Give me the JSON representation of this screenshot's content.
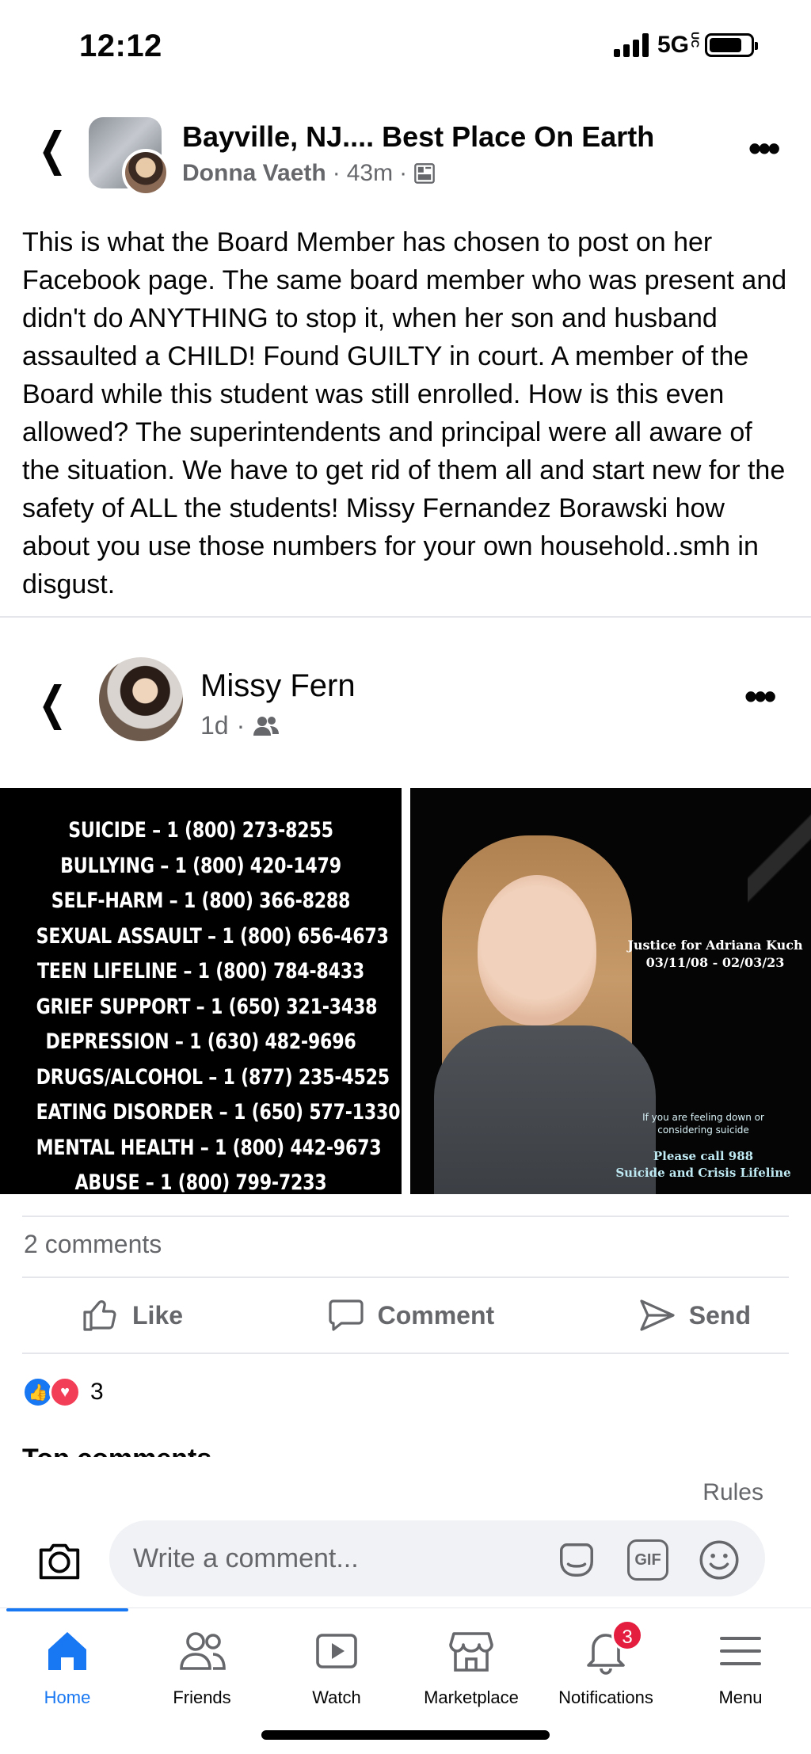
{
  "status_bar": {
    "time": "12:12",
    "network": "5G",
    "network_suffix": "UC"
  },
  "post": {
    "group_name": "Bayville, NJ.... Best Place On Earth",
    "author": "Donna Vaeth",
    "time": "43m",
    "separator": "·",
    "text": "This is what the Board Member has chosen to post on her Facebook page. The same board member who was present and didn't do ANYTHING to stop it, when her son and husband assaulted a CHILD! Found GUILTY in court. A member of the Board while this student was still enrolled. How is this even allowed? The superintendents and principal were all aware of the situation.  We have to get rid of them all and start new for the safety of ALL the students! Missy Fernandez Borawski how about you use those numbers for your own household..smh in disgust.",
    "back_icon": "chevron-left-icon",
    "more_icon": "more-dots-icon"
  },
  "shared_post": {
    "name": "Missy Fern",
    "time": "1d",
    "separator": "·",
    "audience_icon": "friends-icon",
    "hotlines": [
      "SUICIDE – 1 (800) 273-8255",
      "BULLYING – 1 (800) 420-1479",
      "SELF-HARM – 1 (800) 366-8288",
      "SEXUAL ASSAULT – 1 (800) 656-4673",
      "TEEN LIFELINE – 1 (800) 784-8433",
      "GRIEF SUPPORT – 1 (650) 321-3438",
      "DEPRESSION – 1 (630) 482-9696",
      "DRUGS/ALCOHOL – 1 (877) 235-4525",
      "EATING DISORDER – 1 (650) 577-1330",
      "MENTAL HEALTH – 1 (800) 442-9673",
      "ABUSE – 1 (800) 799-7233"
    ],
    "photo_justice_line1": "Justice for Adriana Kuch",
    "photo_justice_line2": "03/11/08 - 02/03/23",
    "photo_feeling_line1": "If you are feeling down or",
    "photo_feeling_line2": "considering suicide",
    "photo_call_line1": "Please call 988",
    "photo_call_line2": "Suicide and Crisis Lifeline"
  },
  "engagement": {
    "comments_count": "2 comments",
    "like_label": "Like",
    "comment_label": "Comment",
    "send_label": "Send",
    "reactions_count": "3",
    "top_comments_label": "Top comments ⌄",
    "like_color": "#1877f2",
    "love_color": "#f33e58"
  },
  "composer": {
    "rules_label": "Rules",
    "placeholder": "Write a comment...",
    "gif_label": "GIF"
  },
  "bottom_nav": {
    "items": [
      {
        "label": "Home",
        "icon": "home-icon"
      },
      {
        "label": "Friends",
        "icon": "friends-icon"
      },
      {
        "label": "Watch",
        "icon": "watch-icon"
      },
      {
        "label": "Marketplace",
        "icon": "marketplace-icon"
      },
      {
        "label": "Notifications",
        "icon": "bell-icon"
      },
      {
        "label": "Menu",
        "icon": "menu-icon"
      }
    ],
    "notifications_badge": "3",
    "active_color": "#1877f2"
  }
}
